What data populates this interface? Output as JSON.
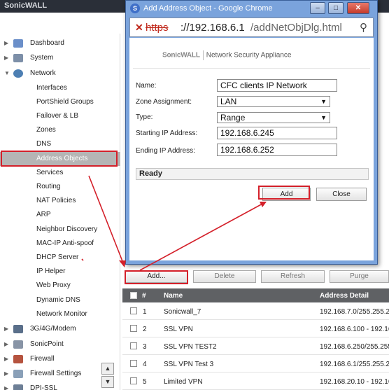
{
  "topbar": {
    "brand": "SonicWALL"
  },
  "sidebar": {
    "items": [
      {
        "label": "Dashboard",
        "arrow": "▶"
      },
      {
        "label": "System",
        "arrow": "▶"
      },
      {
        "label": "Network",
        "arrow": "▼"
      },
      {
        "label": "Interfaces"
      },
      {
        "label": "PortShield Groups"
      },
      {
        "label": "Failover & LB"
      },
      {
        "label": "Zones"
      },
      {
        "label": "DNS"
      },
      {
        "label": "Address Objects"
      },
      {
        "label": "Services"
      },
      {
        "label": "Routing"
      },
      {
        "label": "NAT Policies"
      },
      {
        "label": "ARP"
      },
      {
        "label": "Neighbor Discovery"
      },
      {
        "label": "MAC-IP Anti-spoof"
      },
      {
        "label": "DHCP Server"
      },
      {
        "label": "IP Helper"
      },
      {
        "label": "Web Proxy"
      },
      {
        "label": "Dynamic DNS"
      },
      {
        "label": "Network Monitor"
      },
      {
        "label": "3G/4G/Modem",
        "arrow": "▶"
      },
      {
        "label": "SonicPoint",
        "arrow": "▶"
      },
      {
        "label": "Firewall",
        "arrow": "▶"
      },
      {
        "label": "Firewall Settings",
        "arrow": "▶"
      },
      {
        "label": "DPI-SSL",
        "arrow": "▶"
      }
    ],
    "scroll_up": "▲",
    "scroll_down": "▼"
  },
  "toolbar": {
    "add": "Add...",
    "delete": "Delete",
    "refresh": "Refresh",
    "purge": "Purge"
  },
  "grid": {
    "headers": {
      "num": "#",
      "name": "Name",
      "detail": "Address Detail"
    },
    "rows": [
      {
        "num": "1",
        "name": "Sonicwall_7",
        "detail": "192.168.7.0/255.255.255"
      },
      {
        "num": "2",
        "name": "SSL VPN",
        "detail": "192.168.6.100 - 192.16"
      },
      {
        "num": "3",
        "name": "SSL VPN TEST2",
        "detail": "192.168.6.250/255.255.25"
      },
      {
        "num": "4",
        "name": "SSL VPN Test 3",
        "detail": "192.168.6.1/255.255.255"
      },
      {
        "num": "5",
        "name": "Limited VPN",
        "detail": "192.168.20.10 - 192.16"
      }
    ]
  },
  "dialog": {
    "title": "Add Address Object - Google Chrome",
    "logo": "S",
    "win_min": "–",
    "win_max": "□",
    "win_close": "✕",
    "url": {
      "scheme": "https",
      "host": "://192.168.6.1",
      "path": "/addNetObjDlg.html"
    },
    "brand1": "SonicWALL",
    "brand2": "Network Security Appliance",
    "form": {
      "name_label": "Name:",
      "name_value": "CFC clients IP Network",
      "zone_label": "Zone Assignment:",
      "zone_value": "LAN",
      "type_label": "Type:",
      "type_value": "Range",
      "start_label": "Starting IP Address:",
      "start_value": "192.168.6.245",
      "end_label": "Ending IP Address:",
      "end_value": "192.168.6.252"
    },
    "status": "Ready",
    "add_button": "Add",
    "close_button": "Close"
  },
  "colors": {
    "annotation": "#d4202a",
    "dialog_frame": "#7aa3dc",
    "grid_header": "#5f6164"
  }
}
